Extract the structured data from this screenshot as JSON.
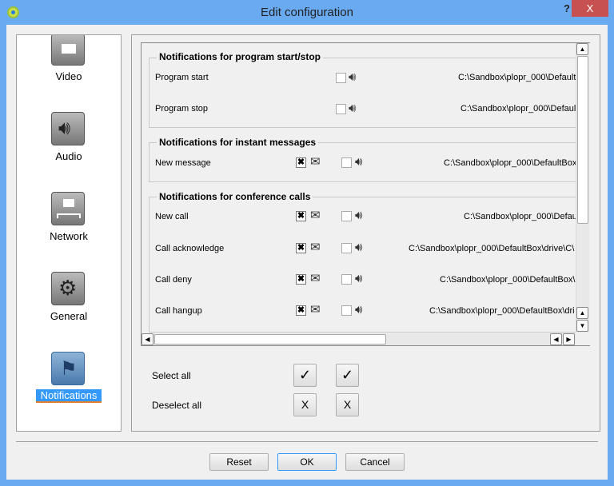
{
  "window": {
    "title": "Edit configuration",
    "help": "?",
    "close": "X"
  },
  "sidebar": {
    "items": [
      {
        "label": "Video",
        "icon": "video-icon"
      },
      {
        "label": "Audio",
        "icon": "speaker-icon"
      },
      {
        "label": "Network",
        "icon": "network-icon"
      },
      {
        "label": "General",
        "icon": "gears-icon"
      },
      {
        "label": "Notifications",
        "icon": "flag-icon",
        "selected": true
      }
    ]
  },
  "groups": [
    {
      "title": "Notifications for program start/stop",
      "rows": [
        {
          "label": "Program start",
          "mail": null,
          "sound": false,
          "path": "C:\\Sandbox\\plopr_000\\Default"
        },
        {
          "label": "Program stop",
          "mail": null,
          "sound": false,
          "path": "C:\\Sandbox\\plopr_000\\Defaul"
        }
      ]
    },
    {
      "title": "Notifications for instant messages",
      "rows": [
        {
          "label": "New message",
          "mail": true,
          "sound": false,
          "path": "C:\\Sandbox\\plopr_000\\DefaultBox"
        }
      ]
    },
    {
      "title": "Notifications for conference calls",
      "rows": [
        {
          "label": "New call",
          "mail": true,
          "sound": false,
          "path": "C:\\Sandbox\\plopr_000\\Defau"
        },
        {
          "label": "Call acknowledge",
          "mail": true,
          "sound": false,
          "path": "C:\\Sandbox\\plopr_000\\DefaultBox\\drive\\C\\"
        },
        {
          "label": "Call deny",
          "mail": true,
          "sound": false,
          "path": "C:\\Sandbox\\plopr_000\\DefaultBox\\"
        },
        {
          "label": "Call hangup",
          "mail": true,
          "sound": false,
          "path": "C:\\Sandbox\\plopr_000\\DefaultBox\\dri"
        }
      ]
    }
  ],
  "bulk": {
    "select_all": "Select all",
    "deselect_all": "Deselect all",
    "check": "✓",
    "x": "X"
  },
  "footer": {
    "reset": "Reset",
    "ok": "OK",
    "cancel": "Cancel"
  },
  "colors": {
    "titlebar": "#6aaaf0",
    "close": "#c75050",
    "selection": "#3399ff"
  }
}
